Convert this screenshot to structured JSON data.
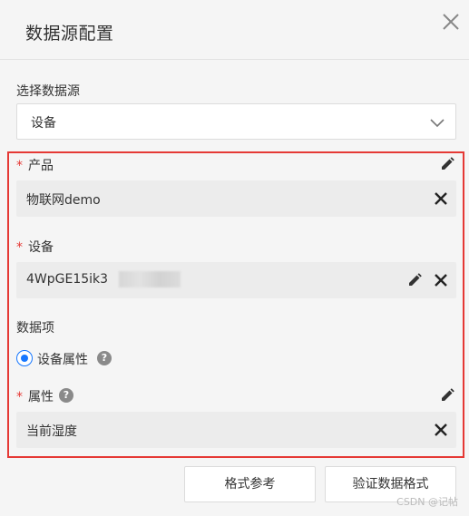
{
  "dialog": {
    "title": "数据源配置"
  },
  "datasource": {
    "label": "选择数据源",
    "selected": "设备"
  },
  "fields": {
    "product": {
      "required_mark": "*",
      "label": "产品",
      "value": "物联网demo"
    },
    "device": {
      "required_mark": "*",
      "label": "设备",
      "value": "4WpGE15ik3"
    },
    "data_items": {
      "label": "数据项",
      "option_label": "设备属性"
    },
    "attribute": {
      "required_mark": "*",
      "label": "属性",
      "value": "当前湿度"
    }
  },
  "buttons": {
    "format_ref": "格式参考",
    "validate_format": "验证数据格式"
  },
  "watermark": "CSDN @记帖",
  "colors": {
    "required": "#e53935",
    "radio_accent": "#1677ff",
    "highlight_border": "#e53935"
  },
  "icons": {
    "close": "close-icon",
    "chevron": "chevron-down-icon",
    "edit": "pencil-icon",
    "clear": "x-icon",
    "help": "question-icon"
  }
}
